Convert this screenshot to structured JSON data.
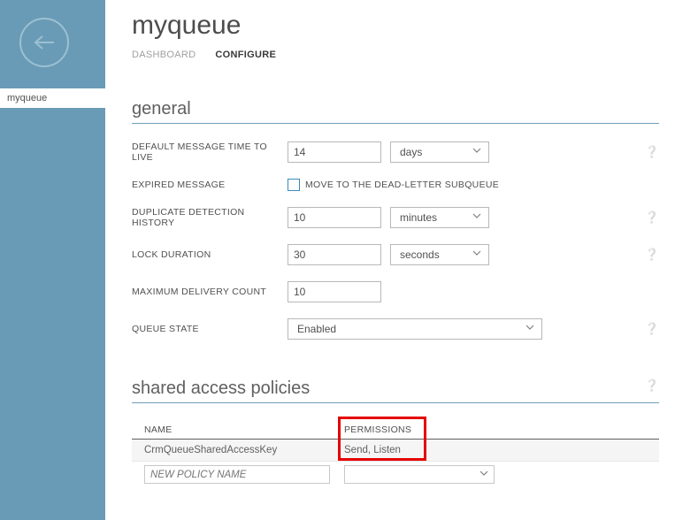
{
  "sidebar": {
    "active_item": "myqueue"
  },
  "header": {
    "title": "myqueue"
  },
  "tabs": {
    "dashboard": "DASHBOARD",
    "configure": "CONFIGURE"
  },
  "sections": {
    "general": "general",
    "policies": "shared access policies"
  },
  "fields": {
    "ttl_label": "DEFAULT MESSAGE TIME TO LIVE",
    "ttl_value": "14",
    "ttl_unit": "days",
    "expired_label": "EXPIRED MESSAGE",
    "expired_checkbox_label": "MOVE TO THE DEAD-LETTER SUBQUEUE",
    "dup_label": "DUPLICATE DETECTION HISTORY",
    "dup_value": "10",
    "dup_unit": "minutes",
    "lock_label": "LOCK DURATION",
    "lock_value": "30",
    "lock_unit": "seconds",
    "max_delivery_label": "MAXIMUM DELIVERY COUNT",
    "max_delivery_value": "10",
    "state_label": "QUEUE STATE",
    "state_value": "Enabled"
  },
  "policies_table": {
    "col_name": "NAME",
    "col_perm": "PERMISSIONS",
    "rows": [
      {
        "name": "CrmQueueSharedAccessKey",
        "permissions": "Send, Listen"
      }
    ],
    "new_placeholder": "NEW POLICY NAME"
  }
}
